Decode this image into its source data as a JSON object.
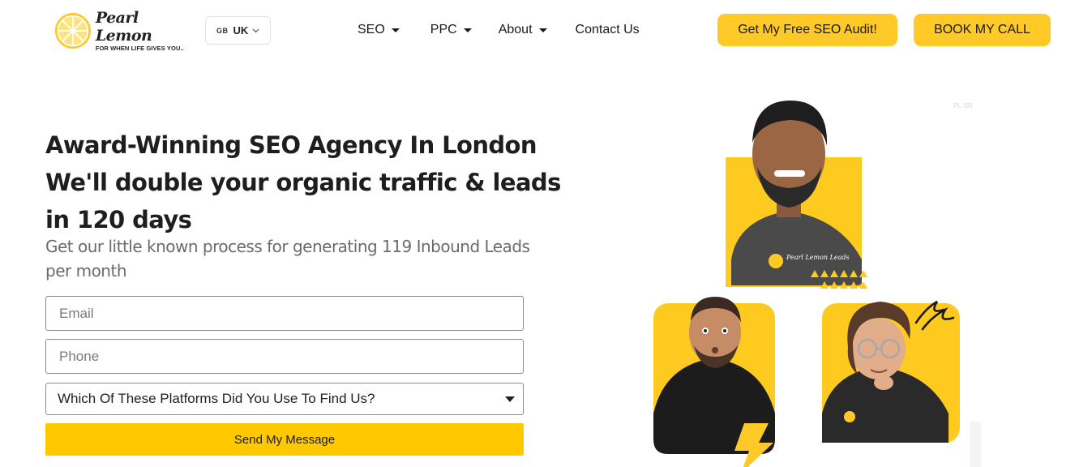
{
  "header": {
    "logo": {
      "name": "Pearl Lemon",
      "tagline": "FOR WHEN LIFE GIVES YOU.."
    },
    "region": {
      "flag_code": "GB",
      "label": "UK"
    },
    "nav": [
      {
        "label": "SEO",
        "has_dropdown": true
      },
      {
        "label": "PPC",
        "has_dropdown": true
      },
      {
        "label": "About",
        "has_dropdown": true
      },
      {
        "label": "Contact Us",
        "has_dropdown": false
      }
    ],
    "cta_audit": "Get My Free SEO Audit!",
    "cta_call": "BOOK MY CALL"
  },
  "hero": {
    "title_lines": [
      "Award-Winning SEO Agency  In  London",
      "We'll double your organic traffic & leads",
      "in 120 days"
    ],
    "subtitle": "Get our little known process for generating 119  Inbound  Leads per month"
  },
  "form": {
    "email_placeholder": "Email",
    "phone_placeholder": "Phone",
    "platform_select": "Which Of These Platforms Did You Use To Find Us?",
    "submit": "Send My Message"
  },
  "artwork": {
    "shirt_logo_text": "Pearl Lemon Leads",
    "corner_text": "PL-SR"
  },
  "colors": {
    "accent": "#ffc928",
    "button_send": "#ffc800",
    "text": "#1e1e1e",
    "subtext": "#6b6b6b"
  }
}
